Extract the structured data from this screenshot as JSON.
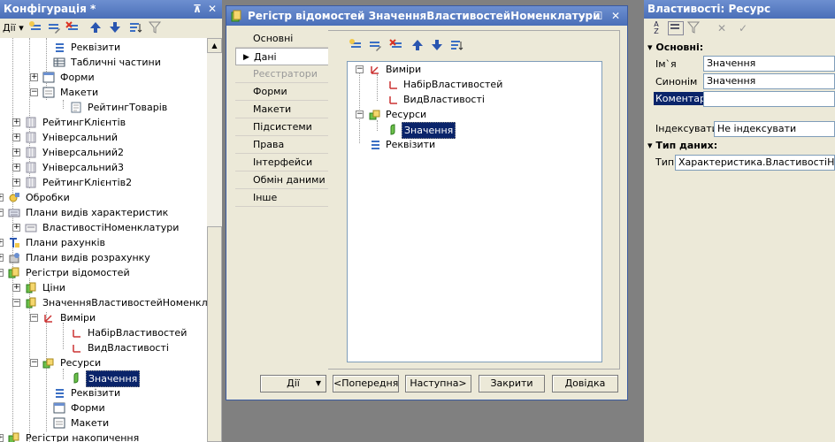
{
  "config_panel": {
    "title": "Конфігурація *",
    "pin": "⊼",
    "close": "✕",
    "actions_label": "Дії",
    "tree": [
      {
        "label": "Реквізити",
        "icon": "attributes-icon"
      },
      {
        "label": "Табличні частини",
        "icon": "table-parts-icon"
      },
      {
        "label": "Форми",
        "icon": "forms-icon"
      },
      {
        "label": "Макети",
        "icon": "templates-icon"
      },
      {
        "label": "РейтингТоварів",
        "icon": "template-item-icon"
      },
      {
        "label": "РейтингКлієнтів",
        "icon": "catalog-icon"
      },
      {
        "label": "Універсальний",
        "icon": "catalog-icon"
      },
      {
        "label": "Універсальний2",
        "icon": "catalog-icon"
      },
      {
        "label": "Універсальний3",
        "icon": "catalog-icon"
      },
      {
        "label": "РейтингКлієнтів2",
        "icon": "catalog-icon"
      },
      {
        "label": "Обробки",
        "icon": "data-processors-icon"
      },
      {
        "label": "Плани видів характеристик",
        "icon": "chart-of-characteristics-icon"
      },
      {
        "label": "ВластивостіНоменклатури",
        "icon": "chart-of-characteristics-item-icon"
      },
      {
        "label": "Плани рахунків",
        "icon": "chart-of-accounts-icon"
      },
      {
        "label": "Плани видів розрахунку",
        "icon": "chart-of-calculation-icon"
      },
      {
        "label": "Регістри відомостей",
        "icon": "information-registers-icon"
      },
      {
        "label": "Ціни",
        "icon": "register-icon"
      },
      {
        "label": "ЗначенняВластивостейНоменклатури",
        "icon": "register-icon"
      },
      {
        "label": "Виміри",
        "icon": "dimensions-icon"
      },
      {
        "label": "НабірВластивостей",
        "icon": "dimension-icon"
      },
      {
        "label": "ВидВластивості",
        "icon": "dimension-icon"
      },
      {
        "label": "Ресурси",
        "icon": "resources-icon"
      },
      {
        "label": "Значення",
        "icon": "resource-icon"
      },
      {
        "label": "Реквізити",
        "icon": "attributes-icon"
      },
      {
        "label": "Форми",
        "icon": "forms-icon"
      },
      {
        "label": "Макети",
        "icon": "templates-icon"
      },
      {
        "label": "Регістри накопичення",
        "icon": "accumulation-registers-icon"
      }
    ]
  },
  "register_window": {
    "title": "Регістр відомостей ЗначенняВластивостейНоменклатури",
    "minimize": "–",
    "maximize": "☐",
    "close": "✕",
    "tabs": [
      {
        "label": "Основні"
      },
      {
        "label": "Дані"
      },
      {
        "label": "Реєстратори"
      },
      {
        "label": "Форми"
      },
      {
        "label": "Макети"
      },
      {
        "label": "Підсистеми"
      },
      {
        "label": "Права"
      },
      {
        "label": "Інтерфейси"
      },
      {
        "label": "Обмін даними"
      },
      {
        "label": "Інше"
      }
    ],
    "data_tree": [
      {
        "label": "Виміри"
      },
      {
        "label": "НабірВластивостей"
      },
      {
        "label": "ВидВластивості"
      },
      {
        "label": "Ресурси"
      },
      {
        "label": "Значення"
      },
      {
        "label": "Реквізити"
      }
    ],
    "buttons": {
      "actions": "Дії",
      "back": "<Попередня",
      "next": "Наступна>",
      "close": "Закрити",
      "help": "Довідка"
    }
  },
  "properties_panel": {
    "title": "Властивості: Ресурс",
    "section_main": "Основні:",
    "name_label": "Ім`я",
    "name_value": "Значення",
    "synonym_label": "Синонім",
    "synonym_value": "Значення",
    "comment_label": "Коментар",
    "comment_value": "",
    "index_label": "Індексувати",
    "index_value": "Не індексувати",
    "section_type": "Тип даних:",
    "type_label": "Тип",
    "type_value": "Характеристика.ВластивостіНоменклатури"
  },
  "colors": {
    "titlebar": "#4a6fb8",
    "selection": "#0a246a",
    "panel_bg": "#ece9d8",
    "desktop": "#808080"
  }
}
